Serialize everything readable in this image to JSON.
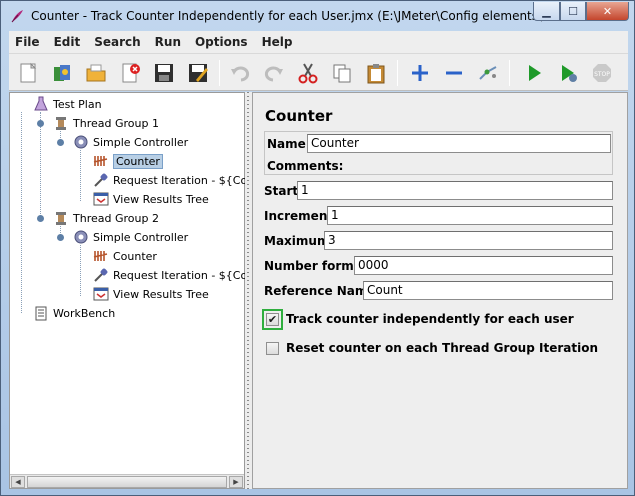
{
  "window": {
    "title": "Counter - Track Counter Independently for each User.jmx (E:\\JMeter\\Config elements\\Cou..."
  },
  "menu": [
    "File",
    "Edit",
    "Search",
    "Run",
    "Options",
    "Help"
  ],
  "toolbar": {
    "icons": [
      "new-icon",
      "templates-icon",
      "open-icon",
      "close-icon",
      "save-icon",
      "save-as-icon",
      "undo-icon",
      "redo-icon",
      "cut-icon",
      "copy-icon",
      "paste-icon",
      "expand-icon",
      "collapse-icon",
      "toggle-icon",
      "start-icon",
      "start-no-timers-icon",
      "stop-icon"
    ]
  },
  "tree": {
    "test_plan": "Test Plan",
    "thread_group_1": "Thread Group 1",
    "simple_controller_1": "Simple Controller",
    "counter_1": "Counter",
    "request_1": "Request Iteration - ${Coun",
    "results_1": "View Results Tree",
    "thread_group_2": "Thread Group 2",
    "simple_controller_2": "Simple Controller",
    "counter_2": "Counter",
    "request_2": "Request Iteration - ${Coun",
    "results_2": "View Results Tree",
    "workbench": "WorkBench"
  },
  "panel": {
    "title": "Counter",
    "name_label": "Name:",
    "name_value": "Counter",
    "comments_label": "Comments:",
    "start_label": "Start",
    "start_value": "1",
    "increment_label": "Increment",
    "increment_value": "1",
    "maximum_label": "Maximum",
    "maximum_value": "3",
    "format_label": "Number format",
    "format_value": "0000",
    "reference_label": "Reference Name",
    "reference_value": "Count",
    "track_label": "Track counter independently for each user",
    "track_checked": true,
    "reset_label": "Reset counter on each Thread Group Iteration",
    "reset_checked": false
  },
  "colors": {
    "selection": "#b8cfe5",
    "highlight": "#2fae3e"
  }
}
